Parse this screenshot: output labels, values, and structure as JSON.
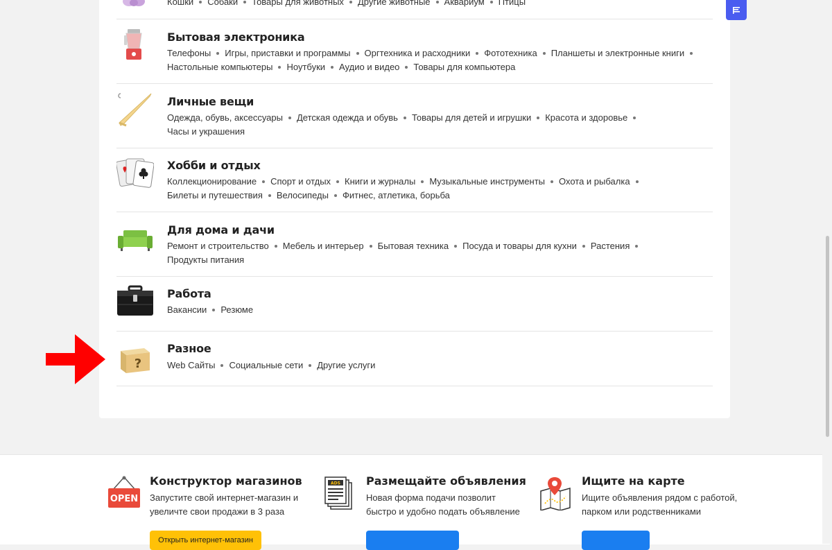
{
  "top_category": {
    "subcategories": [
      "Кошки",
      "Собаки",
      "Товары для животных",
      "Другие животные",
      "Аквариум",
      "Птицы"
    ]
  },
  "categories": [
    {
      "title": "Бытовая электроника",
      "icon": "blender-icon",
      "subcategories": [
        "Телефоны",
        "Игры, приставки и программы",
        "Оргтехника и расходники",
        "Фототехника",
        "Планшеты и электронные книги",
        "Настольные компьютеры",
        "Ноутбуки",
        "Аудио и видео",
        "Товары для компьютера"
      ]
    },
    {
      "title": "Личные вещи",
      "icon": "hanger-icon",
      "subcategories": [
        "Одежда, обувь, аксессуары",
        "Детская одежда и обувь",
        "Товары для детей и игрушки",
        "Красота и здоровье",
        "Часы и украшения"
      ]
    },
    {
      "title": "Хобби и отдых",
      "icon": "playing-cards-icon",
      "subcategories": [
        "Коллекционирование",
        "Спорт и отдых",
        "Книги и журналы",
        "Музыкальные инструменты",
        "Охота и рыбалка",
        "Билеты и путешествия",
        "Велосипеды",
        "Фитнес, атлетика, борьба"
      ]
    },
    {
      "title": "Для дома и дачи",
      "icon": "sofa-icon",
      "subcategories": [
        "Ремонт и строительство",
        "Мебель и интерьер",
        "Бытовая техника",
        "Посуда и товары для кухни",
        "Растения",
        "Продукты питания"
      ]
    },
    {
      "title": "Работа",
      "icon": "briefcase-icon",
      "subcategories": [
        "Вакансии",
        "Резюме"
      ]
    },
    {
      "title": "Разное",
      "icon": "question-box-icon",
      "subcategories": [
        "Web Сайты",
        "Социальные сети",
        "Другие услуги"
      ]
    }
  ],
  "footer": {
    "promos": [
      {
        "title": "Конструктор магазинов",
        "text": "Запустите свой интернет-магазин и увеличте свои продажи в 3 раза",
        "button": "Открыть интернет-магазин",
        "icon": "open-sign-icon",
        "icon_text": "OPEN"
      },
      {
        "title": "Размещайте объявления",
        "text": "Новая форма подачи позволит быстро и удобно подать объявление",
        "button": "",
        "icon": "ads-newspaper-icon",
        "icon_text": "ADS"
      },
      {
        "title": "Ищите на карте",
        "text": "Ищите объявления рядом с работой, парком или родственниками",
        "button": "",
        "icon": "map-pin-icon"
      }
    ]
  },
  "colors": {
    "accent_blue": "#1a7ef0",
    "accent_yellow": "#ffc107",
    "arrow_red": "#ff0000",
    "corner_button": "#4a5cf0"
  }
}
